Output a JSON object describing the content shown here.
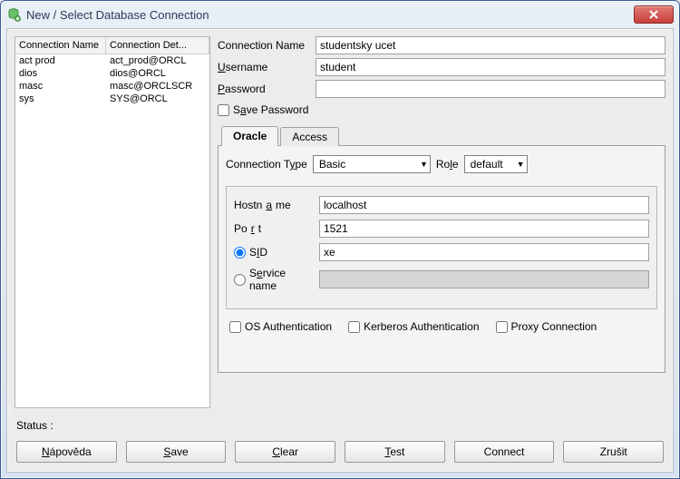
{
  "title": "New / Select Database Connection",
  "connections": {
    "col_name": "Connection Name",
    "col_det": "Connection Det...",
    "rows": [
      {
        "name": "act prod",
        "detail": "act_prod@ORCL"
      },
      {
        "name": "dios",
        "detail": "dios@ORCL"
      },
      {
        "name": "masc",
        "detail": "masc@ORCLSCR"
      },
      {
        "name": "sys",
        "detail": "SYS@ORCL"
      }
    ]
  },
  "form": {
    "conn_name_label": "Connection Name",
    "conn_name_value": "studentsky ucet",
    "username_label_pre": "U",
    "username_label_rest": "sername",
    "username_value": "student",
    "password_label_pre": "P",
    "password_label_rest": "assword",
    "password_value": "",
    "save_password_label": "Save Password"
  },
  "tabs": {
    "oracle": "Oracle",
    "access": "Access"
  },
  "oracle": {
    "conn_type_label": "Connection Type",
    "conn_type_value": "Basic",
    "role_label": "Role",
    "role_value": "default",
    "hostname_label": "Hostname",
    "hostname_value": "localhost",
    "port_label": "Port",
    "port_value": "1521",
    "sid_label_pre": "S",
    "sid_label_mid": "I",
    "sid_label_post": "D",
    "sid_value": "xe",
    "service_label_pre": "S",
    "service_label_mid": "e",
    "service_label_post": "rvice name",
    "service_value": "",
    "os_auth": "OS Authentication",
    "krb_auth": "Kerberos Authentication",
    "proxy": "Proxy Connection"
  },
  "status_label": "Status :",
  "buttons": {
    "help": "Nápověda",
    "save": "Save",
    "clear": "Clear",
    "test": "Test",
    "connect": "Connect",
    "cancel": "Zrušit"
  }
}
